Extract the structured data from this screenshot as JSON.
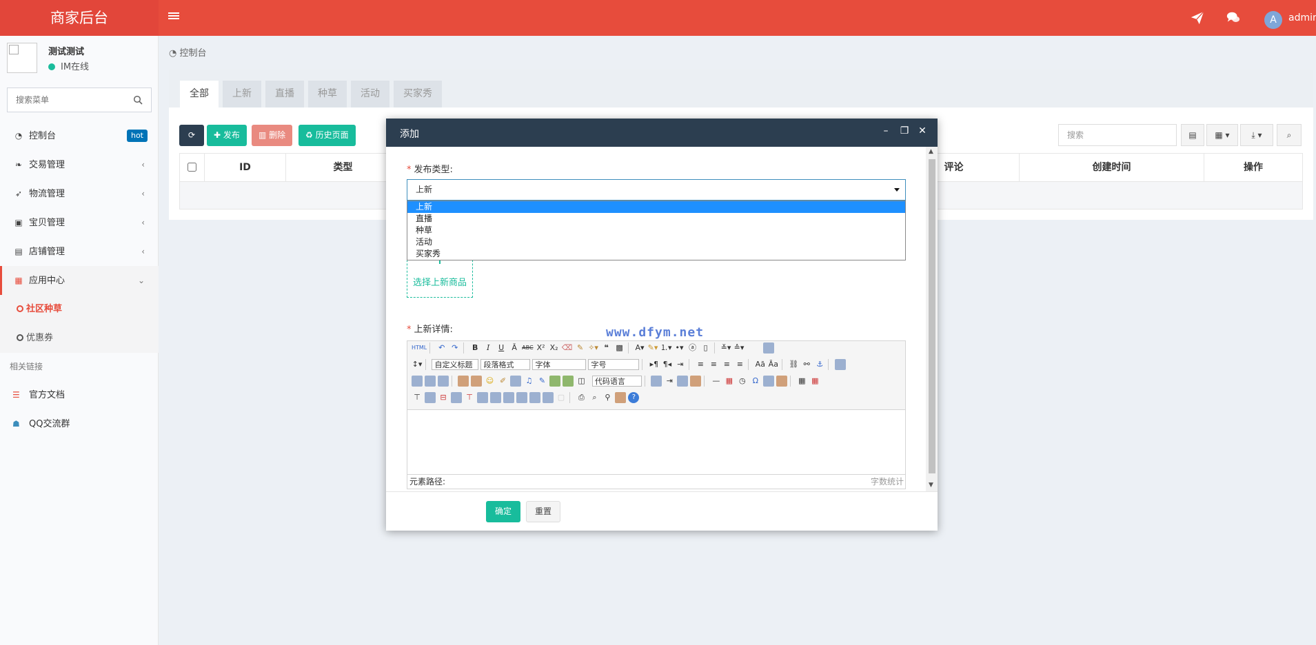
{
  "header": {
    "logo": "商家后台",
    "avatar_letter": "A",
    "username": "admin",
    "icons": [
      "menu-icon",
      "send-icon",
      "comments-icon"
    ]
  },
  "sidebar": {
    "user_name": "测试测试",
    "user_status": "IM在线",
    "search_placeholder": "搜索菜单",
    "menu": [
      {
        "label": "控制台",
        "icon": "dashboard-icon",
        "badge": "hot"
      },
      {
        "label": "交易管理",
        "icon": "leaf-icon"
      },
      {
        "label": "物流管理",
        "icon": "rocket-icon"
      },
      {
        "label": "宝贝管理",
        "icon": "bag-icon"
      },
      {
        "label": "店铺管理",
        "icon": "archive-icon"
      },
      {
        "label": "应用中心",
        "icon": "grid-icon"
      }
    ],
    "submenu": [
      {
        "label": "社区种草"
      },
      {
        "label": "优惠券"
      }
    ],
    "links_header": "相关链接",
    "links": [
      {
        "label": "官方文档",
        "icon": "list-icon"
      },
      {
        "label": "QQ交流群",
        "icon": "qq-icon"
      }
    ]
  },
  "content": {
    "breadcrumb": "控制台",
    "tabs": [
      "全部",
      "上新",
      "直播",
      "种草",
      "活动",
      "买家秀"
    ],
    "toolbar": {
      "publish": "发布",
      "delete": "删除",
      "history": "历史页面"
    },
    "search_placeholder": "搜索",
    "columns": [
      "ID",
      "类型",
      "评论",
      "创建时间",
      "操作"
    ]
  },
  "modal": {
    "title": "添加",
    "publish_type_label": "发布类型:",
    "selected_type": "上新",
    "type_options": [
      "上新",
      "直播",
      "种草",
      "活动",
      "买家秀"
    ],
    "choose_goods": "选择上新商品",
    "detail_label": "上新详情:",
    "watermark": "www.dfym.net",
    "editor": {
      "custom_title": "自定义标题",
      "paragraph": "段落格式",
      "font": "字体",
      "font_size": "字号",
      "code_lang": "代码语言",
      "path_label": "元素路径:",
      "word_count": "字数统计",
      "html_btn": "HTML"
    },
    "ok": "确定",
    "reset": "重置"
  },
  "colors": {
    "brand": "#e74c3c",
    "modal_header": "#2c3e50",
    "primary_green": "#18bc9c",
    "danger": "#e98a80",
    "dark_btn": "#2c3e50"
  }
}
